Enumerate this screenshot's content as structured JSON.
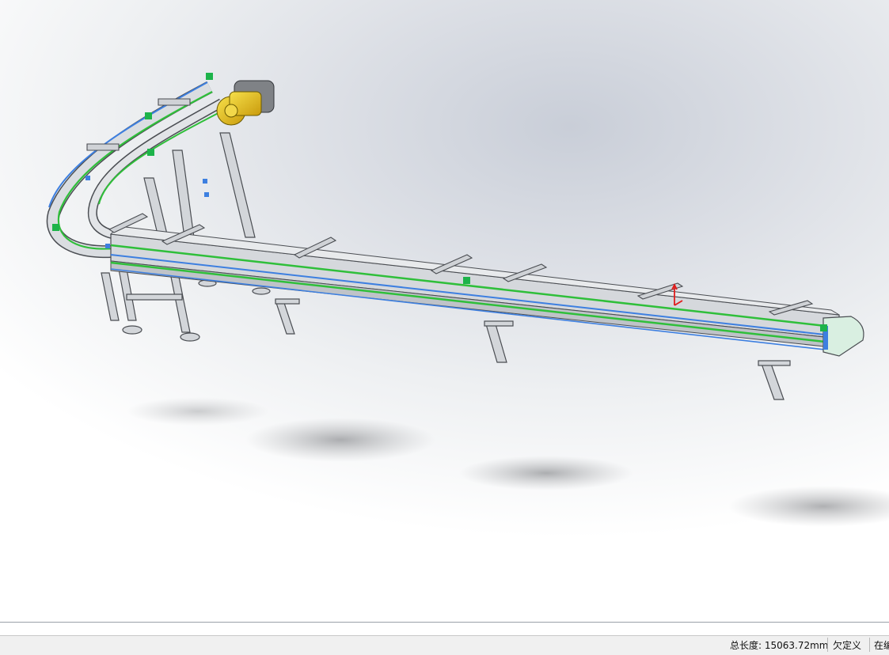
{
  "model_view": {
    "description_icon": "conveyor-assembly-model"
  },
  "status_bar": {
    "total_length": "总长度: 15063.72mm",
    "definition_state": "欠定义",
    "edit_state": "在编"
  },
  "colors": {
    "frame_steel": "#c9ccd1",
    "frame_edge": "#4a4d52",
    "chain_green": "#2fbf3a",
    "sketch_blue": "#3d7fe0",
    "motor_yellow": "#e8c21a",
    "handle_green": "#1db34a",
    "axis_red": "#e21b1b",
    "shadow": "#8c8e92"
  }
}
